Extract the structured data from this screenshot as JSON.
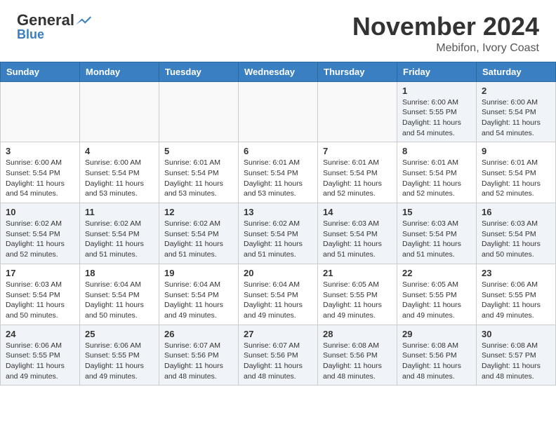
{
  "header": {
    "logo_general": "General",
    "logo_blue": "Blue",
    "month": "November 2024",
    "location": "Mebifon, Ivory Coast"
  },
  "weekdays": [
    "Sunday",
    "Monday",
    "Tuesday",
    "Wednesday",
    "Thursday",
    "Friday",
    "Saturday"
  ],
  "rows": [
    [
      {
        "day": "",
        "sunrise": "",
        "sunset": "",
        "daylight": ""
      },
      {
        "day": "",
        "sunrise": "",
        "sunset": "",
        "daylight": ""
      },
      {
        "day": "",
        "sunrise": "",
        "sunset": "",
        "daylight": ""
      },
      {
        "day": "",
        "sunrise": "",
        "sunset": "",
        "daylight": ""
      },
      {
        "day": "",
        "sunrise": "",
        "sunset": "",
        "daylight": ""
      },
      {
        "day": "1",
        "sunrise": "Sunrise: 6:00 AM",
        "sunset": "Sunset: 5:55 PM",
        "daylight": "Daylight: 11 hours and 54 minutes."
      },
      {
        "day": "2",
        "sunrise": "Sunrise: 6:00 AM",
        "sunset": "Sunset: 5:54 PM",
        "daylight": "Daylight: 11 hours and 54 minutes."
      }
    ],
    [
      {
        "day": "3",
        "sunrise": "Sunrise: 6:00 AM",
        "sunset": "Sunset: 5:54 PM",
        "daylight": "Daylight: 11 hours and 54 minutes."
      },
      {
        "day": "4",
        "sunrise": "Sunrise: 6:00 AM",
        "sunset": "Sunset: 5:54 PM",
        "daylight": "Daylight: 11 hours and 53 minutes."
      },
      {
        "day": "5",
        "sunrise": "Sunrise: 6:01 AM",
        "sunset": "Sunset: 5:54 PM",
        "daylight": "Daylight: 11 hours and 53 minutes."
      },
      {
        "day": "6",
        "sunrise": "Sunrise: 6:01 AM",
        "sunset": "Sunset: 5:54 PM",
        "daylight": "Daylight: 11 hours and 53 minutes."
      },
      {
        "day": "7",
        "sunrise": "Sunrise: 6:01 AM",
        "sunset": "Sunset: 5:54 PM",
        "daylight": "Daylight: 11 hours and 52 minutes."
      },
      {
        "day": "8",
        "sunrise": "Sunrise: 6:01 AM",
        "sunset": "Sunset: 5:54 PM",
        "daylight": "Daylight: 11 hours and 52 minutes."
      },
      {
        "day": "9",
        "sunrise": "Sunrise: 6:01 AM",
        "sunset": "Sunset: 5:54 PM",
        "daylight": "Daylight: 11 hours and 52 minutes."
      }
    ],
    [
      {
        "day": "10",
        "sunrise": "Sunrise: 6:02 AM",
        "sunset": "Sunset: 5:54 PM",
        "daylight": "Daylight: 11 hours and 52 minutes."
      },
      {
        "day": "11",
        "sunrise": "Sunrise: 6:02 AM",
        "sunset": "Sunset: 5:54 PM",
        "daylight": "Daylight: 11 hours and 51 minutes."
      },
      {
        "day": "12",
        "sunrise": "Sunrise: 6:02 AM",
        "sunset": "Sunset: 5:54 PM",
        "daylight": "Daylight: 11 hours and 51 minutes."
      },
      {
        "day": "13",
        "sunrise": "Sunrise: 6:02 AM",
        "sunset": "Sunset: 5:54 PM",
        "daylight": "Daylight: 11 hours and 51 minutes."
      },
      {
        "day": "14",
        "sunrise": "Sunrise: 6:03 AM",
        "sunset": "Sunset: 5:54 PM",
        "daylight": "Daylight: 11 hours and 51 minutes."
      },
      {
        "day": "15",
        "sunrise": "Sunrise: 6:03 AM",
        "sunset": "Sunset: 5:54 PM",
        "daylight": "Daylight: 11 hours and 51 minutes."
      },
      {
        "day": "16",
        "sunrise": "Sunrise: 6:03 AM",
        "sunset": "Sunset: 5:54 PM",
        "daylight": "Daylight: 11 hours and 50 minutes."
      }
    ],
    [
      {
        "day": "17",
        "sunrise": "Sunrise: 6:03 AM",
        "sunset": "Sunset: 5:54 PM",
        "daylight": "Daylight: 11 hours and 50 minutes."
      },
      {
        "day": "18",
        "sunrise": "Sunrise: 6:04 AM",
        "sunset": "Sunset: 5:54 PM",
        "daylight": "Daylight: 11 hours and 50 minutes."
      },
      {
        "day": "19",
        "sunrise": "Sunrise: 6:04 AM",
        "sunset": "Sunset: 5:54 PM",
        "daylight": "Daylight: 11 hours and 49 minutes."
      },
      {
        "day": "20",
        "sunrise": "Sunrise: 6:04 AM",
        "sunset": "Sunset: 5:54 PM",
        "daylight": "Daylight: 11 hours and 49 minutes."
      },
      {
        "day": "21",
        "sunrise": "Sunrise: 6:05 AM",
        "sunset": "Sunset: 5:55 PM",
        "daylight": "Daylight: 11 hours and 49 minutes."
      },
      {
        "day": "22",
        "sunrise": "Sunrise: 6:05 AM",
        "sunset": "Sunset: 5:55 PM",
        "daylight": "Daylight: 11 hours and 49 minutes."
      },
      {
        "day": "23",
        "sunrise": "Sunrise: 6:06 AM",
        "sunset": "Sunset: 5:55 PM",
        "daylight": "Daylight: 11 hours and 49 minutes."
      }
    ],
    [
      {
        "day": "24",
        "sunrise": "Sunrise: 6:06 AM",
        "sunset": "Sunset: 5:55 PM",
        "daylight": "Daylight: 11 hours and 49 minutes."
      },
      {
        "day": "25",
        "sunrise": "Sunrise: 6:06 AM",
        "sunset": "Sunset: 5:55 PM",
        "daylight": "Daylight: 11 hours and 49 minutes."
      },
      {
        "day": "26",
        "sunrise": "Sunrise: 6:07 AM",
        "sunset": "Sunset: 5:56 PM",
        "daylight": "Daylight: 11 hours and 48 minutes."
      },
      {
        "day": "27",
        "sunrise": "Sunrise: 6:07 AM",
        "sunset": "Sunset: 5:56 PM",
        "daylight": "Daylight: 11 hours and 48 minutes."
      },
      {
        "day": "28",
        "sunrise": "Sunrise: 6:08 AM",
        "sunset": "Sunset: 5:56 PM",
        "daylight": "Daylight: 11 hours and 48 minutes."
      },
      {
        "day": "29",
        "sunrise": "Sunrise: 6:08 AM",
        "sunset": "Sunset: 5:56 PM",
        "daylight": "Daylight: 11 hours and 48 minutes."
      },
      {
        "day": "30",
        "sunrise": "Sunrise: 6:08 AM",
        "sunset": "Sunset: 5:57 PM",
        "daylight": "Daylight: 11 hours and 48 minutes."
      }
    ]
  ]
}
